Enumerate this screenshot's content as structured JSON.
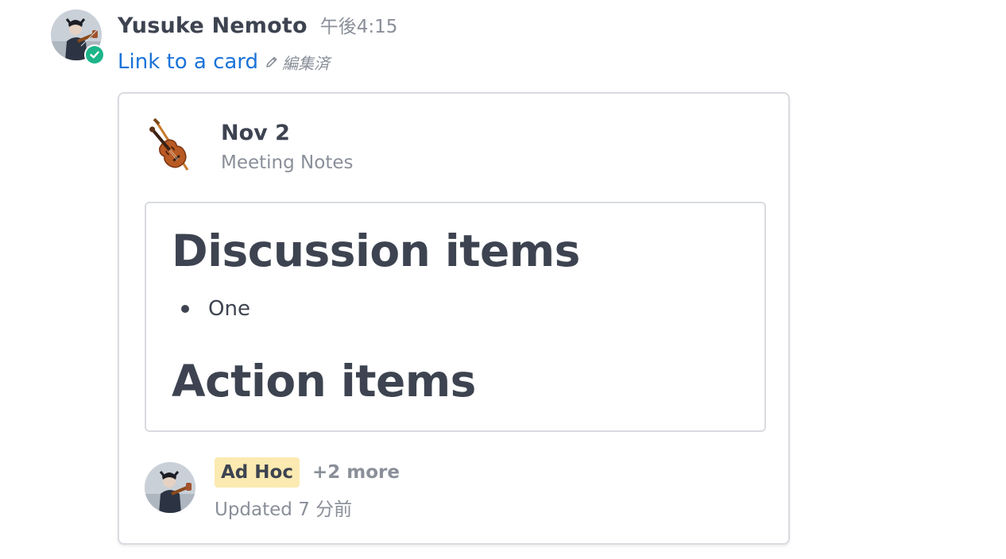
{
  "message": {
    "sender": "Yusuke Nemoto",
    "timestamp": "午後4:15",
    "link_text": "Link to a card",
    "edited_label": "編集済",
    "status_color": "#1cb589",
    "avatar_icon": "violinist-avatar",
    "edit_icon": "pencil-icon"
  },
  "card": {
    "icon": "violin-icon",
    "title": "Nov 2",
    "subtitle": "Meeting Notes",
    "preview": {
      "heading1": "Discussion items",
      "list_items": [
        "One"
      ],
      "heading2": "Action items"
    },
    "footer": {
      "tag": "Ad Hoc",
      "tag_color": "#fbeab1",
      "more": "+2 more",
      "updated": "Updated 7 分前"
    }
  },
  "colors": {
    "link": "#1a73d9",
    "text": "#3d4350",
    "muted": "#8a8f99",
    "border": "#d9dbe0"
  }
}
